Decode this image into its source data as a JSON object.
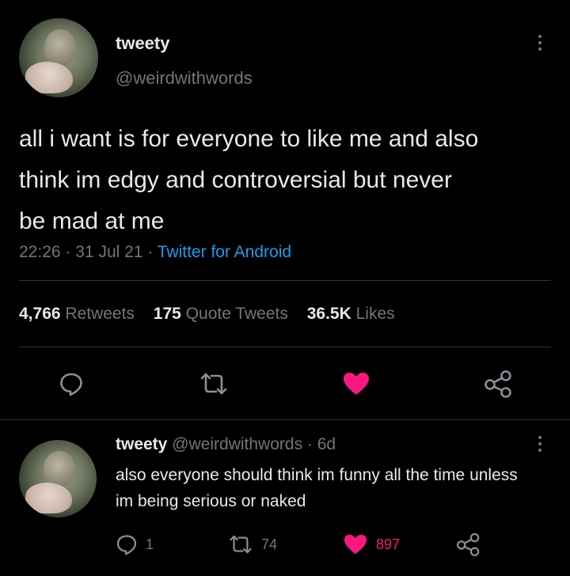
{
  "main_tweet": {
    "author": {
      "display_name": "tweety",
      "handle": "@weirdwithwords"
    },
    "text_lines": [
      "all i want is for everyone to like me and also",
      "think im edgy and controversial but never",
      "be mad at me"
    ],
    "time": "22:26",
    "sep1": "·",
    "date": "31 Jul 21",
    "sep2": "·",
    "source": "Twitter for Android",
    "stats": {
      "retweets_count": "4,766",
      "retweets_label": "Retweets",
      "quotes_count": "175",
      "quotes_label": "Quote Tweets",
      "likes_count": "36.5K",
      "likes_label": "Likes"
    }
  },
  "reply": {
    "author": {
      "display_name": "tweety",
      "handle": "@weirdwithwords"
    },
    "age": "· 6d",
    "text_lines": [
      "also everyone should think im funny all the time unless",
      "im being serious or naked"
    ],
    "counts": {
      "replies": "1",
      "retweets": "74",
      "likes": "897"
    }
  },
  "icons": {
    "reply": "speech-bubble-icon",
    "retweet": "retweet-arrows-icon",
    "like": "heart-icon",
    "share": "share-nodes-icon",
    "more": "vertical-ellipsis-icon"
  },
  "colors": {
    "background": "#000000",
    "text": "#e7e9ea",
    "muted": "#71767b",
    "link": "#1d9bf0",
    "like": "#f91880"
  }
}
